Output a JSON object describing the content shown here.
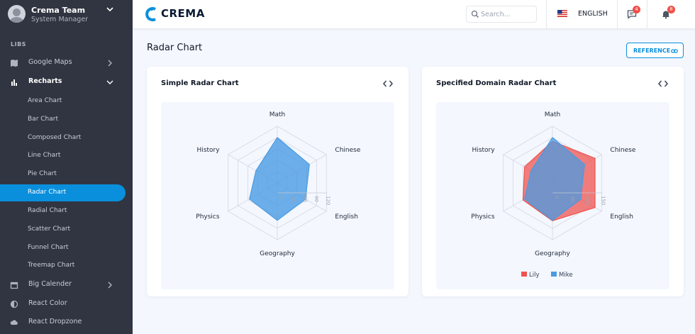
{
  "sidebar": {
    "user": {
      "name": "Crema Team",
      "role": "System Manager"
    },
    "section_label": "LIBS",
    "items": [
      {
        "label": "Google Maps",
        "icon": "map-icon"
      },
      {
        "label": "Recharts",
        "icon": "bar-chart-icon"
      },
      {
        "label": "Big Calender",
        "icon": "calendar-icon"
      },
      {
        "label": "React Color",
        "icon": "contrast-icon"
      },
      {
        "label": "React Dropzone",
        "icon": "cloud-icon"
      }
    ],
    "subitems": [
      {
        "label": "Area Chart"
      },
      {
        "label": "Bar Chart"
      },
      {
        "label": "Composed Chart"
      },
      {
        "label": "Line Chart"
      },
      {
        "label": "Pie Chart"
      },
      {
        "label": "Radar Chart"
      },
      {
        "label": "Radial Chart"
      },
      {
        "label": "Scatter Chart"
      },
      {
        "label": "Funnel Chart"
      },
      {
        "label": "Treemap Chart"
      }
    ]
  },
  "header": {
    "logo": "CREMA",
    "search_placeholder": "Search...",
    "language": "ENGLISH",
    "messages_count": "4",
    "notifications_count": "8"
  },
  "main": {
    "title": "Radar Chart",
    "reference_label": "REFERENCE"
  },
  "colors": {
    "accent": "#0a8fdc",
    "sidebar_bg": "#313541",
    "radar_blue": "#4a9be3",
    "radar_red": "#ef5350"
  },
  "chart_data": [
    {
      "type": "radar",
      "title": "Simple Radar Chart",
      "categories": [
        "Math",
        "Chinese",
        "English",
        "Geography",
        "Physics",
        "History"
      ],
      "ticks": [
        "0",
        "30",
        "60",
        "90",
        "120"
      ],
      "range": [
        0,
        150
      ],
      "series": [
        {
          "values": [
            120,
            98,
            86,
            99,
            85,
            65
          ],
          "color": "#4a9be3"
        }
      ]
    },
    {
      "type": "radar",
      "title": "Specified Domain Radar Chart",
      "categories": [
        "Math",
        "Chinese",
        "English",
        "Geography",
        "Physics",
        "History"
      ],
      "ticks": [
        "0",
        "50",
        "100",
        "150"
      ],
      "range": [
        0,
        150
      ],
      "series": [
        {
          "name": "Lily",
          "values": [
            110,
            130,
            130,
            100,
            90,
            85
          ],
          "color": "#ef5350"
        },
        {
          "name": "Mike",
          "values": [
            120,
            98,
            86,
            99,
            85,
            65
          ],
          "color": "#4a9be3"
        }
      ],
      "legend": [
        "Lily",
        "Mike"
      ]
    }
  ]
}
